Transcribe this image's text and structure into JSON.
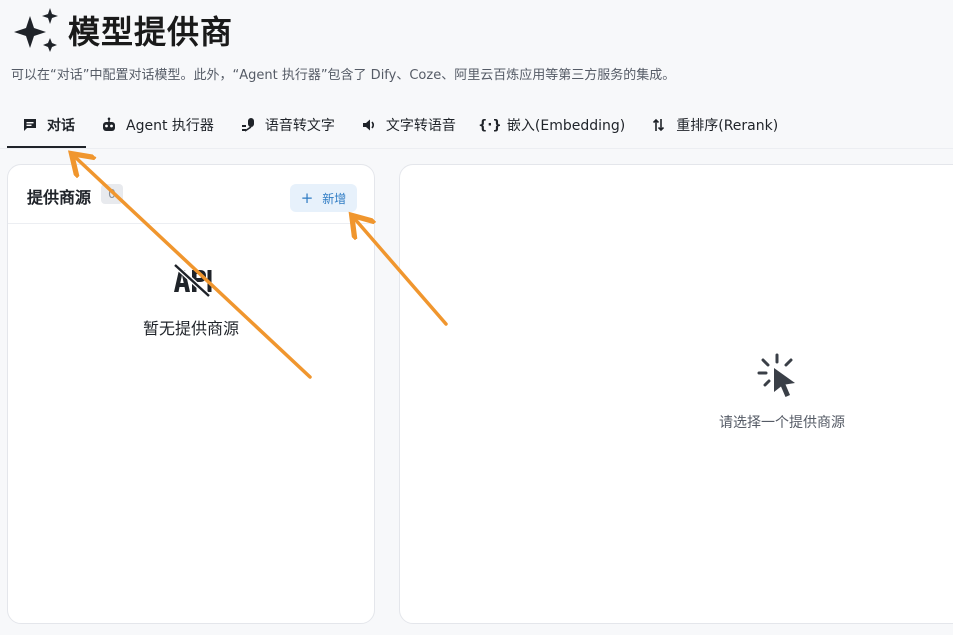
{
  "header": {
    "title": "模型提供商",
    "icon": "sparkle-icon"
  },
  "subtitle": "可以在“对话”中配置对话模型。此外，“Agent 执行器”包含了 Dify、Coze、阿里云百炼应用等第三方服务的集成。",
  "tabs": [
    {
      "label": "对话",
      "icon": "chat-icon",
      "active": true
    },
    {
      "label": "Agent 执行器",
      "icon": "robot-icon",
      "active": false
    },
    {
      "label": "语音转文字",
      "icon": "speech-to-text-icon",
      "active": false
    },
    {
      "label": "文字转语音",
      "icon": "speaker-icon",
      "active": false
    },
    {
      "label": "嵌入(Embedding)",
      "icon": "code-braces-icon",
      "active": false
    },
    {
      "label": "重排序(Rerank)",
      "icon": "sort-icon",
      "active": false
    }
  ],
  "provider_panel": {
    "title": "提供商源",
    "count": "0",
    "add_label": "新增",
    "empty_text": "暂无提供商源",
    "empty_icon": "api-off-icon"
  },
  "detail_panel": {
    "placeholder": "请选择一个提供商源",
    "icon": "cursor-click-icon"
  },
  "colors": {
    "accent": "#2f7cc4",
    "add_button_bg": "#e7f1fb",
    "annotation_arrow": "#f0962e",
    "page_bg": "#f7f8fa"
  }
}
